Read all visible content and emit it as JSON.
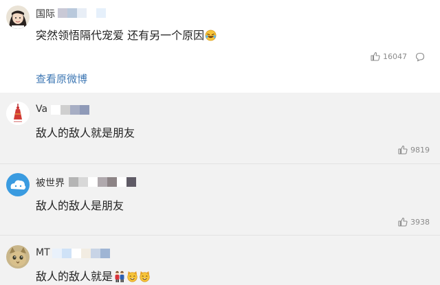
{
  "post": {
    "username": "国际",
    "content": "突然领悟隔代宠爱 还有另一个原因",
    "likes": "16047",
    "view_original": "查看原微博",
    "colors": {
      "link": "#3f78b4",
      "meta": "#8a8a8a"
    }
  },
  "comments": [
    {
      "username": "Va",
      "content": "敌人的敌人就是朋友",
      "likes": "9819",
      "avatar_icon": "red-tassel-avatar-icon"
    },
    {
      "username": "被世界",
      "content": "敌人的敌人是朋友",
      "likes": "3938",
      "avatar_icon": "cloud-avatar-icon"
    },
    {
      "username": "MT",
      "content": "敌人的敌人就是",
      "likes": "",
      "avatar_icon": "cat-avatar-icon",
      "emojis": [
        "couple-emoji-icon",
        "cat-face-emoji-icon",
        "cat-face-emoji-icon"
      ]
    }
  ]
}
